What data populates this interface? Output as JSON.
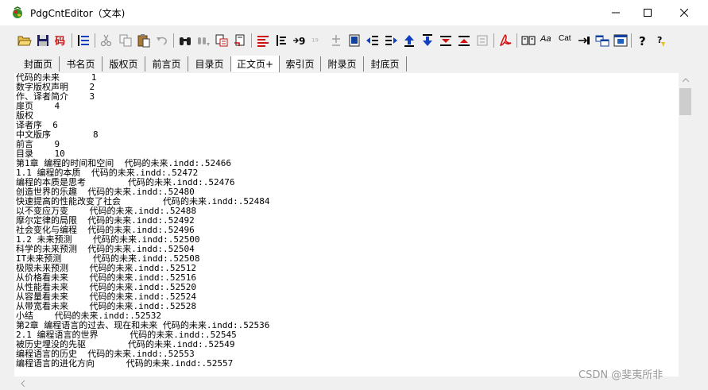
{
  "window": {
    "title": "PdgCntEditor（文本)",
    "minimize_label": "minimize",
    "maximize_label": "maximize",
    "close_label": "close"
  },
  "toolbar": {
    "text_buttons": {
      "aa": "Aa",
      "cat": "Cat"
    }
  },
  "tabs": [
    {
      "label": "封面页",
      "active": false
    },
    {
      "label": "书名页",
      "active": false
    },
    {
      "label": "版权页",
      "active": false
    },
    {
      "label": "前言页",
      "active": false
    },
    {
      "label": "目录页",
      "active": false
    },
    {
      "label": "正文页+",
      "active": true
    },
    {
      "label": "索引页",
      "active": false
    },
    {
      "label": "附录页",
      "active": false
    },
    {
      "label": "封底页",
      "active": false
    }
  ],
  "editor": {
    "lines": [
      "代码的未来      1",
      "数字版权声明    2",
      "作、译者简介    3",
      "扉页    4",
      "版权",
      "译者序  6",
      "中文版序        8",
      "前言    9",
      "目录    10",
      "第1章 编程的时间和空间  代码的未来.indd:.52466",
      "1.1 编程的本质  代码的未来.indd:.52472",
      "编程的本质是思考        代码的未来.indd:.52476",
      "创造世界的乐趣  代码的未来.indd:.52480",
      "快速提高的性能改变了社会        代码的未来.indd:.52484",
      "以不变应万变    代码的未来.indd:.52488",
      "摩尔定律的局限  代码的未来.indd:.52492",
      "社会变化与编程  代码的未来.indd:.52496",
      "1.2 未来预测    代码的未来.indd:.52500",
      "科学的未来预测  代码的未来.indd:.52504",
      "IT未来预测      代码的未来.indd:.52508",
      "极限未来预测    代码的未来.indd:.52512",
      "从价格看未来    代码的未来.indd:.52516",
      "从性能看未来    代码的未来.indd:.52520",
      "从容量看未来    代码的未来.indd:.52524",
      "从带宽看未来    代码的未来.indd:.52528",
      "小结    代码的未来.indd:.52532",
      "第2章 编程语言的过去、现在和未来 代码的未来.indd:.52536",
      "2.1 编程语言的世界      代码的未来.indd:.52545",
      "被历史埋没的先驱        代码的未来.indd:.52549",
      "编程语言的历史  代码的未来.indd:.52553",
      "编程语言的进化方向      代码的未来.indd:.52557"
    ]
  },
  "watermark": "CSDN @斐夷所非"
}
